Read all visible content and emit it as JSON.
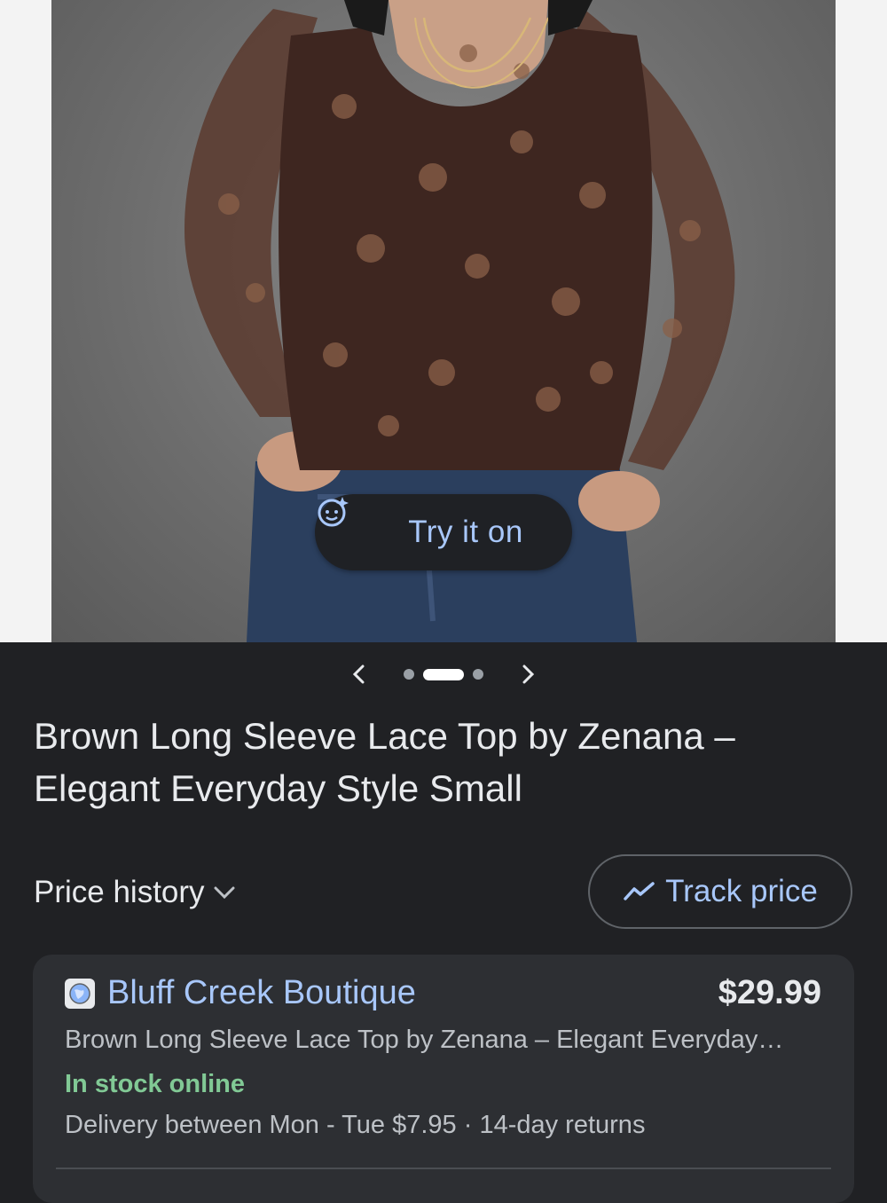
{
  "try_on": {
    "label": "Try it on",
    "icon": "try-on-face-sparkle-icon"
  },
  "carousel": {
    "dot_count": 3,
    "active_index": 1
  },
  "product": {
    "title": "Brown Long Sleeve Lace Top by Zenana – Elegant Everyday Style Small"
  },
  "price_history": {
    "label": "Price history",
    "icon": "chevron-down-icon"
  },
  "track_price": {
    "label": "Track price",
    "icon": "trend-line-icon"
  },
  "offer": {
    "seller": "Bluff Creek Boutique",
    "price": "$29.99",
    "description": "Brown Long Sleeve Lace Top by Zenana – Elegant Everyday…",
    "stock": "In stock online",
    "delivery": "Delivery between Mon - Tue $7.95 · 14-day returns"
  },
  "colors": {
    "background": "#202124",
    "link": "#a8c7fa",
    "in_stock": "#81c995",
    "card": "#2d2f33"
  }
}
